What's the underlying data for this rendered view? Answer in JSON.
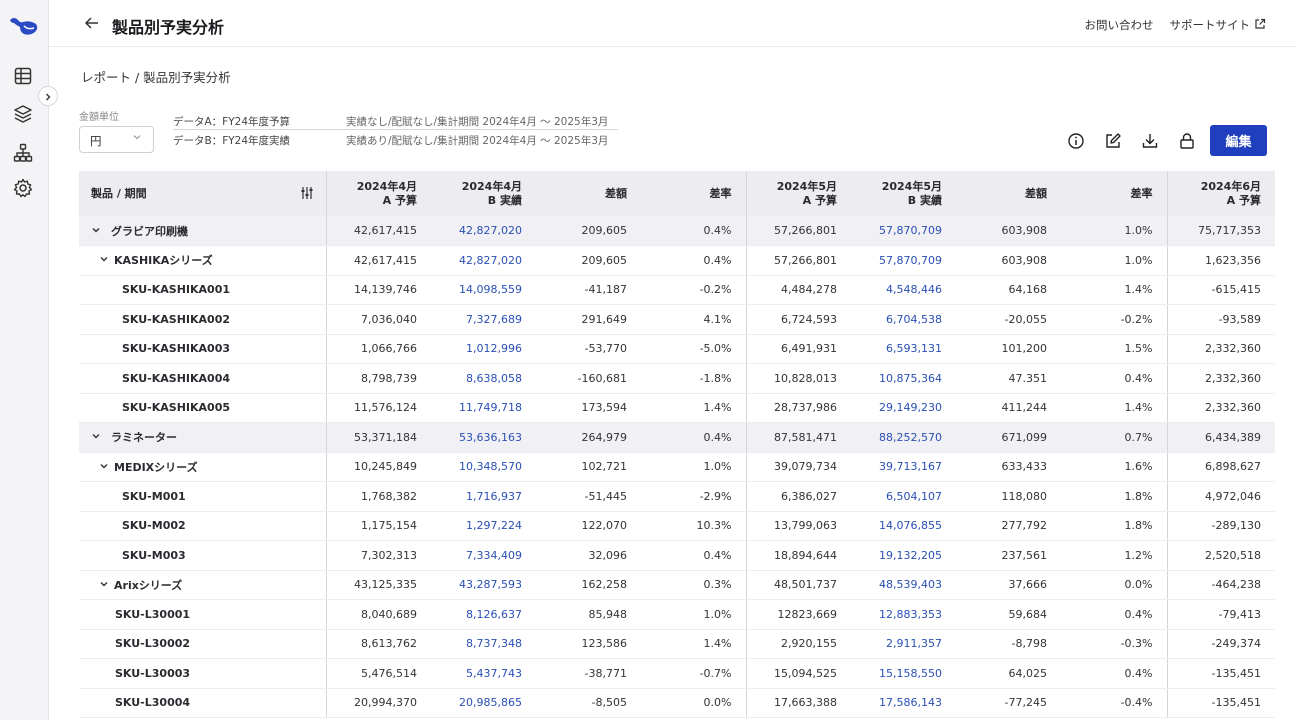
{
  "header": {
    "title": "製品別予実分析",
    "contact_label": "お問い合わせ",
    "support_label": "サポートサイト"
  },
  "breadcrumb": "レポート / 製品別予実分析",
  "unit": {
    "label": "金額単位",
    "value": "円"
  },
  "data_sources": [
    {
      "name": "データA：FY24年度予算",
      "desc": "実績なし/配賦なし/集計期間 2024年4月 ～ 2025年3月"
    },
    {
      "name": "データB：FY24年度実績",
      "desc": "実績あり/配賦なし/集計期間 2024年4月 ～ 2025年3月"
    }
  ],
  "toolbar": {
    "edit_label": "編集"
  },
  "table": {
    "product_header": "製品 / 期間",
    "columns": [
      {
        "top": "2024年4月",
        "sub": "A 予算"
      },
      {
        "top": "2024年4月",
        "sub": "B 実績"
      },
      {
        "top": "",
        "sub": "差額"
      },
      {
        "top": "",
        "sub": "差率"
      },
      {
        "top": "2024年5月",
        "sub": "A 予算"
      },
      {
        "top": "2024年5月",
        "sub": "B 実績"
      },
      {
        "top": "",
        "sub": "差額"
      },
      {
        "top": "",
        "sub": "差率"
      },
      {
        "top": "2024年6月",
        "sub": "A 予算"
      }
    ],
    "rows": [
      {
        "level": 1,
        "name": "グラビア印刷機",
        "cells": [
          "42,617,415",
          "42,827,020",
          "209,605",
          "0.4%",
          "57,266,801",
          "57,870,709",
          "603,908",
          "1.0%",
          "75,717,353"
        ]
      },
      {
        "level": 2,
        "name": "KASHIKAシリーズ",
        "cells": [
          "42,617,415",
          "42,827,020",
          "209,605",
          "0.4%",
          "57,266,801",
          "57,870,709",
          "603,908",
          "1.0%",
          "1,623,356"
        ]
      },
      {
        "level": 3,
        "name": "SKU-KASHIKA001",
        "cells": [
          "14,139,746",
          "14,098,559",
          "-41,187",
          "-0.2%",
          "4,484,278",
          "4,548,446",
          "64,168",
          "1.4%",
          "-615,415"
        ]
      },
      {
        "level": 3,
        "name": "SKU-KASHIKA002",
        "cells": [
          "7,036,040",
          "7,327,689",
          "291,649",
          "4.1%",
          "6,724,593",
          "6,704,538",
          "-20,055",
          "-0.2%",
          "-93,589"
        ]
      },
      {
        "level": 3,
        "name": "SKU-KASHIKA003",
        "cells": [
          "1,066,766",
          "1,012,996",
          "-53,770",
          "-5.0%",
          "6,491,931",
          "6,593,131",
          "101,200",
          "1.5%",
          "2,332,360"
        ]
      },
      {
        "level": 3,
        "name": "SKU-KASHIKA004",
        "cells": [
          "8,798,739",
          "8,638,058",
          "-160,681",
          "-1.8%",
          "10,828,013",
          "10,875,364",
          "47.351",
          "0.4%",
          "2,332,360"
        ]
      },
      {
        "level": 3,
        "name": "SKU-KASHIKA005",
        "cells": [
          "11,576,124",
          "11,749,718",
          "173,594",
          "1.4%",
          "28,737,986",
          "29,149,230",
          "411,244",
          "1.4%",
          "2,332,360"
        ]
      },
      {
        "level": 1,
        "name": "ラミネーター",
        "cells": [
          "53,371,184",
          "53,636,163",
          "264,979",
          "0.4%",
          "87,581,471",
          "88,252,570",
          "671,099",
          "0.7%",
          "6,434,389"
        ]
      },
      {
        "level": 2,
        "name": "MEDIXシリーズ",
        "cells": [
          "10,245,849",
          "10,348,570",
          "102,721",
          "1.0%",
          "39,079,734",
          "39,713,167",
          "633,433",
          "1.6%",
          "6,898,627"
        ]
      },
      {
        "level": 3,
        "name": "SKU-M001",
        "cells": [
          "1,768,382",
          "1,716,937",
          "-51,445",
          "-2.9%",
          "6,386,027",
          "6,504,107",
          "118,080",
          "1.8%",
          "4,972,046"
        ]
      },
      {
        "level": 3,
        "name": "SKU-M002",
        "cells": [
          "1,175,154",
          "1,297,224",
          "122,070",
          "10.3%",
          "13,799,063",
          "14,076,855",
          "277,792",
          "1.8%",
          "-289,130"
        ]
      },
      {
        "level": 3,
        "name": "SKU-M003",
        "cells": [
          "7,302,313",
          "7,334,409",
          "32,096",
          "0.4%",
          "18,894,644",
          "19,132,205",
          "237,561",
          "1.2%",
          "2,520,518"
        ]
      },
      {
        "level": 2,
        "name": "Arixシリーズ",
        "cells": [
          "43,125,335",
          "43,287,593",
          "162,258",
          "0.3%",
          "48,501,737",
          "48,539,403",
          "37,666",
          "0.0%",
          "-464,238"
        ]
      },
      {
        "level": 4,
        "name": "SKU-L30001",
        "cells": [
          "8,040,689",
          "8,126,637",
          "85,948",
          "1.0%",
          "12823,669",
          "12,883,353",
          "59,684",
          "0.4%",
          "-79,413"
        ]
      },
      {
        "level": 4,
        "name": "SKU-L30002",
        "cells": [
          "8,613,762",
          "8,737,348",
          "123,586",
          "1.4%",
          "2,920,155",
          "2,911,357",
          "-8,798",
          "-0.3%",
          "-249,374"
        ]
      },
      {
        "level": 4,
        "name": "SKU-L30003",
        "cells": [
          "5,476,514",
          "5,437,743",
          "-38,771",
          "-0.7%",
          "15,094,525",
          "15,158,550",
          "64,025",
          "0.4%",
          "-135,451"
        ]
      },
      {
        "level": 4,
        "name": "SKU-L30004",
        "cells": [
          "20,994,370",
          "20,985,865",
          "-8,505",
          "0.0%",
          "17,663,388",
          "17,586,143",
          "-77,245",
          "-0.4%",
          "-135,451"
        ]
      }
    ]
  },
  "colors": {
    "accent": "#1f3fbf",
    "link_value": "#2a4fb5",
    "group_row": "#f1f1f5",
    "header_bg": "#ececf1"
  },
  "icons": [
    "whale-logo-icon",
    "table-icon",
    "layers-icon",
    "hierarchy-icon",
    "gear-icon",
    "chevron-right-icon",
    "back-arrow-icon",
    "external-link-icon",
    "info-icon",
    "edit-icon",
    "download-icon",
    "lock-icon",
    "filter-icon",
    "chevron-down-icon"
  ]
}
